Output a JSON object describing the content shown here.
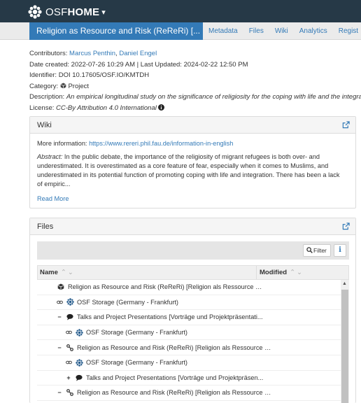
{
  "header": {
    "brand_osf": "OSF",
    "brand_home": "HOME",
    "caret": "▾"
  },
  "project": {
    "title": "Religion as Resource and Risk (ReReRi) [...",
    "nav": [
      "Metadata",
      "Files",
      "Wiki",
      "Analytics",
      "Regist"
    ]
  },
  "meta": {
    "contributors_label": "Contributors:",
    "contributors": [
      "Marcus Penthin",
      "Daniel Engel"
    ],
    "dates": "Date created: 2022-07-26 10:29 AM | Last Updated: 2024-02-22 12:50 PM",
    "identifier": "Identifier: DOI 10.17605/OSF.IO/KMTDH",
    "category_label": "Category:",
    "category": "Project",
    "description_label": "Description:",
    "description": "An empirical longitudinal study on the significance of religiosity for the coping with life and the integration",
    "license_label": "License:",
    "license": "CC-By Attribution 4.0 International"
  },
  "wiki": {
    "title": "Wiki",
    "more_info_label": "More information:",
    "more_info_url": "https://www.rereri.phil.fau.de/information-in-english",
    "abstract_label": "Abstract:",
    "abstract_lines": [
      "In the public debate, the importance of the religiosity of migrant refugees is both over- and",
      "underestimated. It is overestimated as a core feature of fear, especially when it comes to Muslims, and",
      "underestimated in its potential function of promoting coping with life and integration. There has been a lack",
      "of empiric..."
    ],
    "read_more": "Read More"
  },
  "files": {
    "title": "Files",
    "filter_label": "Filter",
    "info_label": "i",
    "col_name": "Name",
    "col_modified": "Modified",
    "sort_glyph": "⌃⌄",
    "rows": [
      {
        "control": "",
        "icon": "cube-icon",
        "indent": 0,
        "name": "Religion as Resource and Risk (ReReRi) [Religion als Ressource und ..."
      },
      {
        "control": "link",
        "icon": "storage-icon",
        "indent": 1,
        "name": "OSF Storage (Germany - Frankfurt)"
      },
      {
        "control": "−",
        "icon": "comment-icon",
        "indent": 1,
        "name": "Talks and Project Presentations [Vorträge und Projektpräsentati..."
      },
      {
        "control": "link",
        "icon": "storage-icon",
        "indent": 2,
        "name": "OSF Storage (Germany - Frankfurt)"
      },
      {
        "control": "−",
        "icon": "component-icon",
        "indent": 1,
        "name": "Religion as Resource and Risk (ReReRi) [Religion als Ressource u..."
      },
      {
        "control": "link",
        "icon": "storage-icon",
        "indent": 2,
        "name": "OSF Storage (Germany - Frankfurt)"
      },
      {
        "control": "+",
        "icon": "comment-icon",
        "indent": 2,
        "name": "Talks and Project Presentations [Vorträge und Projektpräsen..."
      },
      {
        "control": "−",
        "icon": "component-icon",
        "indent": 1,
        "name": "Religion as Resource and Risk (ReReRi) [Religion als Ressource u..."
      }
    ]
  },
  "colors": {
    "topbar": "#263947",
    "accent": "#337ab7"
  }
}
